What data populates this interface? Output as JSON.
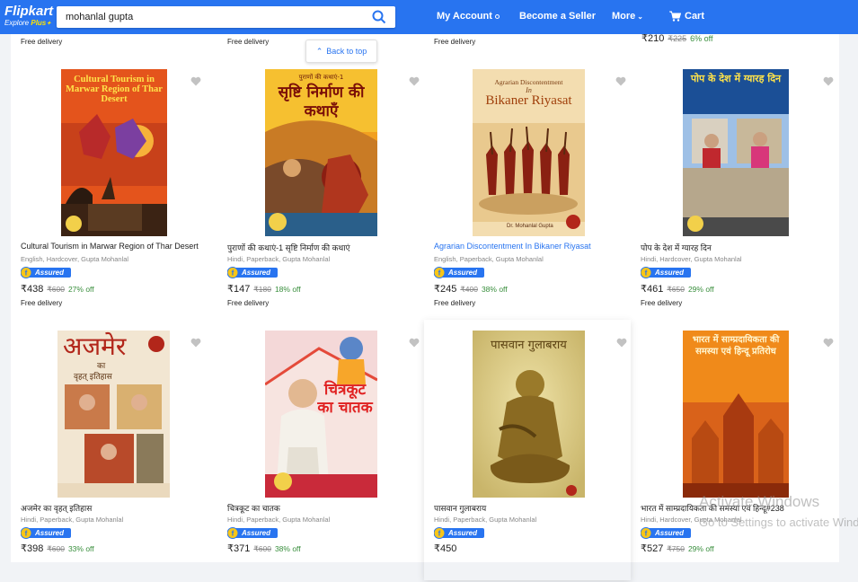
{
  "header": {
    "logo": "Flipkart",
    "logo_sub": "Explore",
    "logo_plus": "Plus",
    "search_value": "mohanlal gupta",
    "account": "My Account",
    "seller": "Become a Seller",
    "more": "More",
    "cart": "Cart",
    "color": "#2874f0"
  },
  "back_to_top": "Back to top",
  "top_strip": {
    "delivery_1": "Free delivery",
    "delivery_2": "Free delivery",
    "delivery_3": "Free delivery",
    "price": "₹210",
    "mrp": "₹225",
    "off": "6% off"
  },
  "assured_label": "Assured",
  "products": [
    {
      "title": "Cultural Tourism in Marwar Region of Thar Desert",
      "meta": "English, Hardcover, Gupta Mohanlal",
      "price": "₹438",
      "mrp": "₹600",
      "off": "27% off",
      "delivery": "Free delivery",
      "cover_title": "Cultural Tourism in Marwar Region of Thar Desert"
    },
    {
      "title": "पुराणों की कथाएं-1 सृष्टि निर्माण की कथाएं",
      "meta": "Hindi, Paperback, Gupta Mohanlal",
      "price": "₹147",
      "mrp": "₹180",
      "off": "18% off",
      "delivery": "Free delivery",
      "cover_top": "पुराणों की कथाएं-1",
      "cover_title": "सृष्टि निर्माण की कथाएँ"
    },
    {
      "title": "Agrarian Discontentment In Bikaner Riyasat",
      "meta": "English, Paperback, Gupta Mohanlal",
      "price": "₹245",
      "mrp": "₹400",
      "off": "38% off",
      "delivery": "Free delivery",
      "cover_top": "Agrarian Discontentment",
      "cover_in": "In",
      "cover_title": "Bikaner Riyasat",
      "cover_author": "Dr. Mohanlal Gupta"
    },
    {
      "title": "पोप के देश में ग्यारह दिन",
      "meta": "Hindi, Hardcover, Gupta Mohanlal",
      "price": "₹461",
      "mrp": "₹650",
      "off": "29% off",
      "delivery": "Free delivery",
      "cover_title": "पोप के देश में ग्यारह दिन"
    },
    {
      "title": "अजमेर का वृहत् इतिहास",
      "meta": "Hindi, Paperback, Gupta Mohanlal",
      "price": "₹398",
      "mrp": "₹600",
      "off": "33% off",
      "delivery": "",
      "cover_title": "अजमेर",
      "cover_mid": "का",
      "cover_sub": "वृहत् इतिहास"
    },
    {
      "title": "चित्रकूट का चातक",
      "meta": "Hindi, Paperback, Gupta Mohanlal",
      "price": "₹371",
      "mrp": "₹600",
      "off": "38% off",
      "delivery": "",
      "cover_title": "चित्रकूट का चातक"
    },
    {
      "title": "पासवान गुलाबराय",
      "meta": "Hindi, Paperback, Gupta Mohanlal",
      "price": "₹450",
      "mrp": "",
      "off": "",
      "delivery": "",
      "cover_title": "पासवान गुलाबराय"
    },
    {
      "title": "भारत में साम्प्रदायिकता की समस्या एवं हिन्दू#238",
      "meta": "Hindi, Hardcover, Gupta Mohanlal",
      "price": "₹527",
      "mrp": "₹750",
      "off": "29% off",
      "delivery": "",
      "cover_title": "भारत में साम्प्रदायिकता की समस्या एवं हिन्दू प्रतिरोध"
    }
  ],
  "watermark": {
    "line1": "Activate Windows",
    "line2": "Go to Settings to activate Windows."
  }
}
